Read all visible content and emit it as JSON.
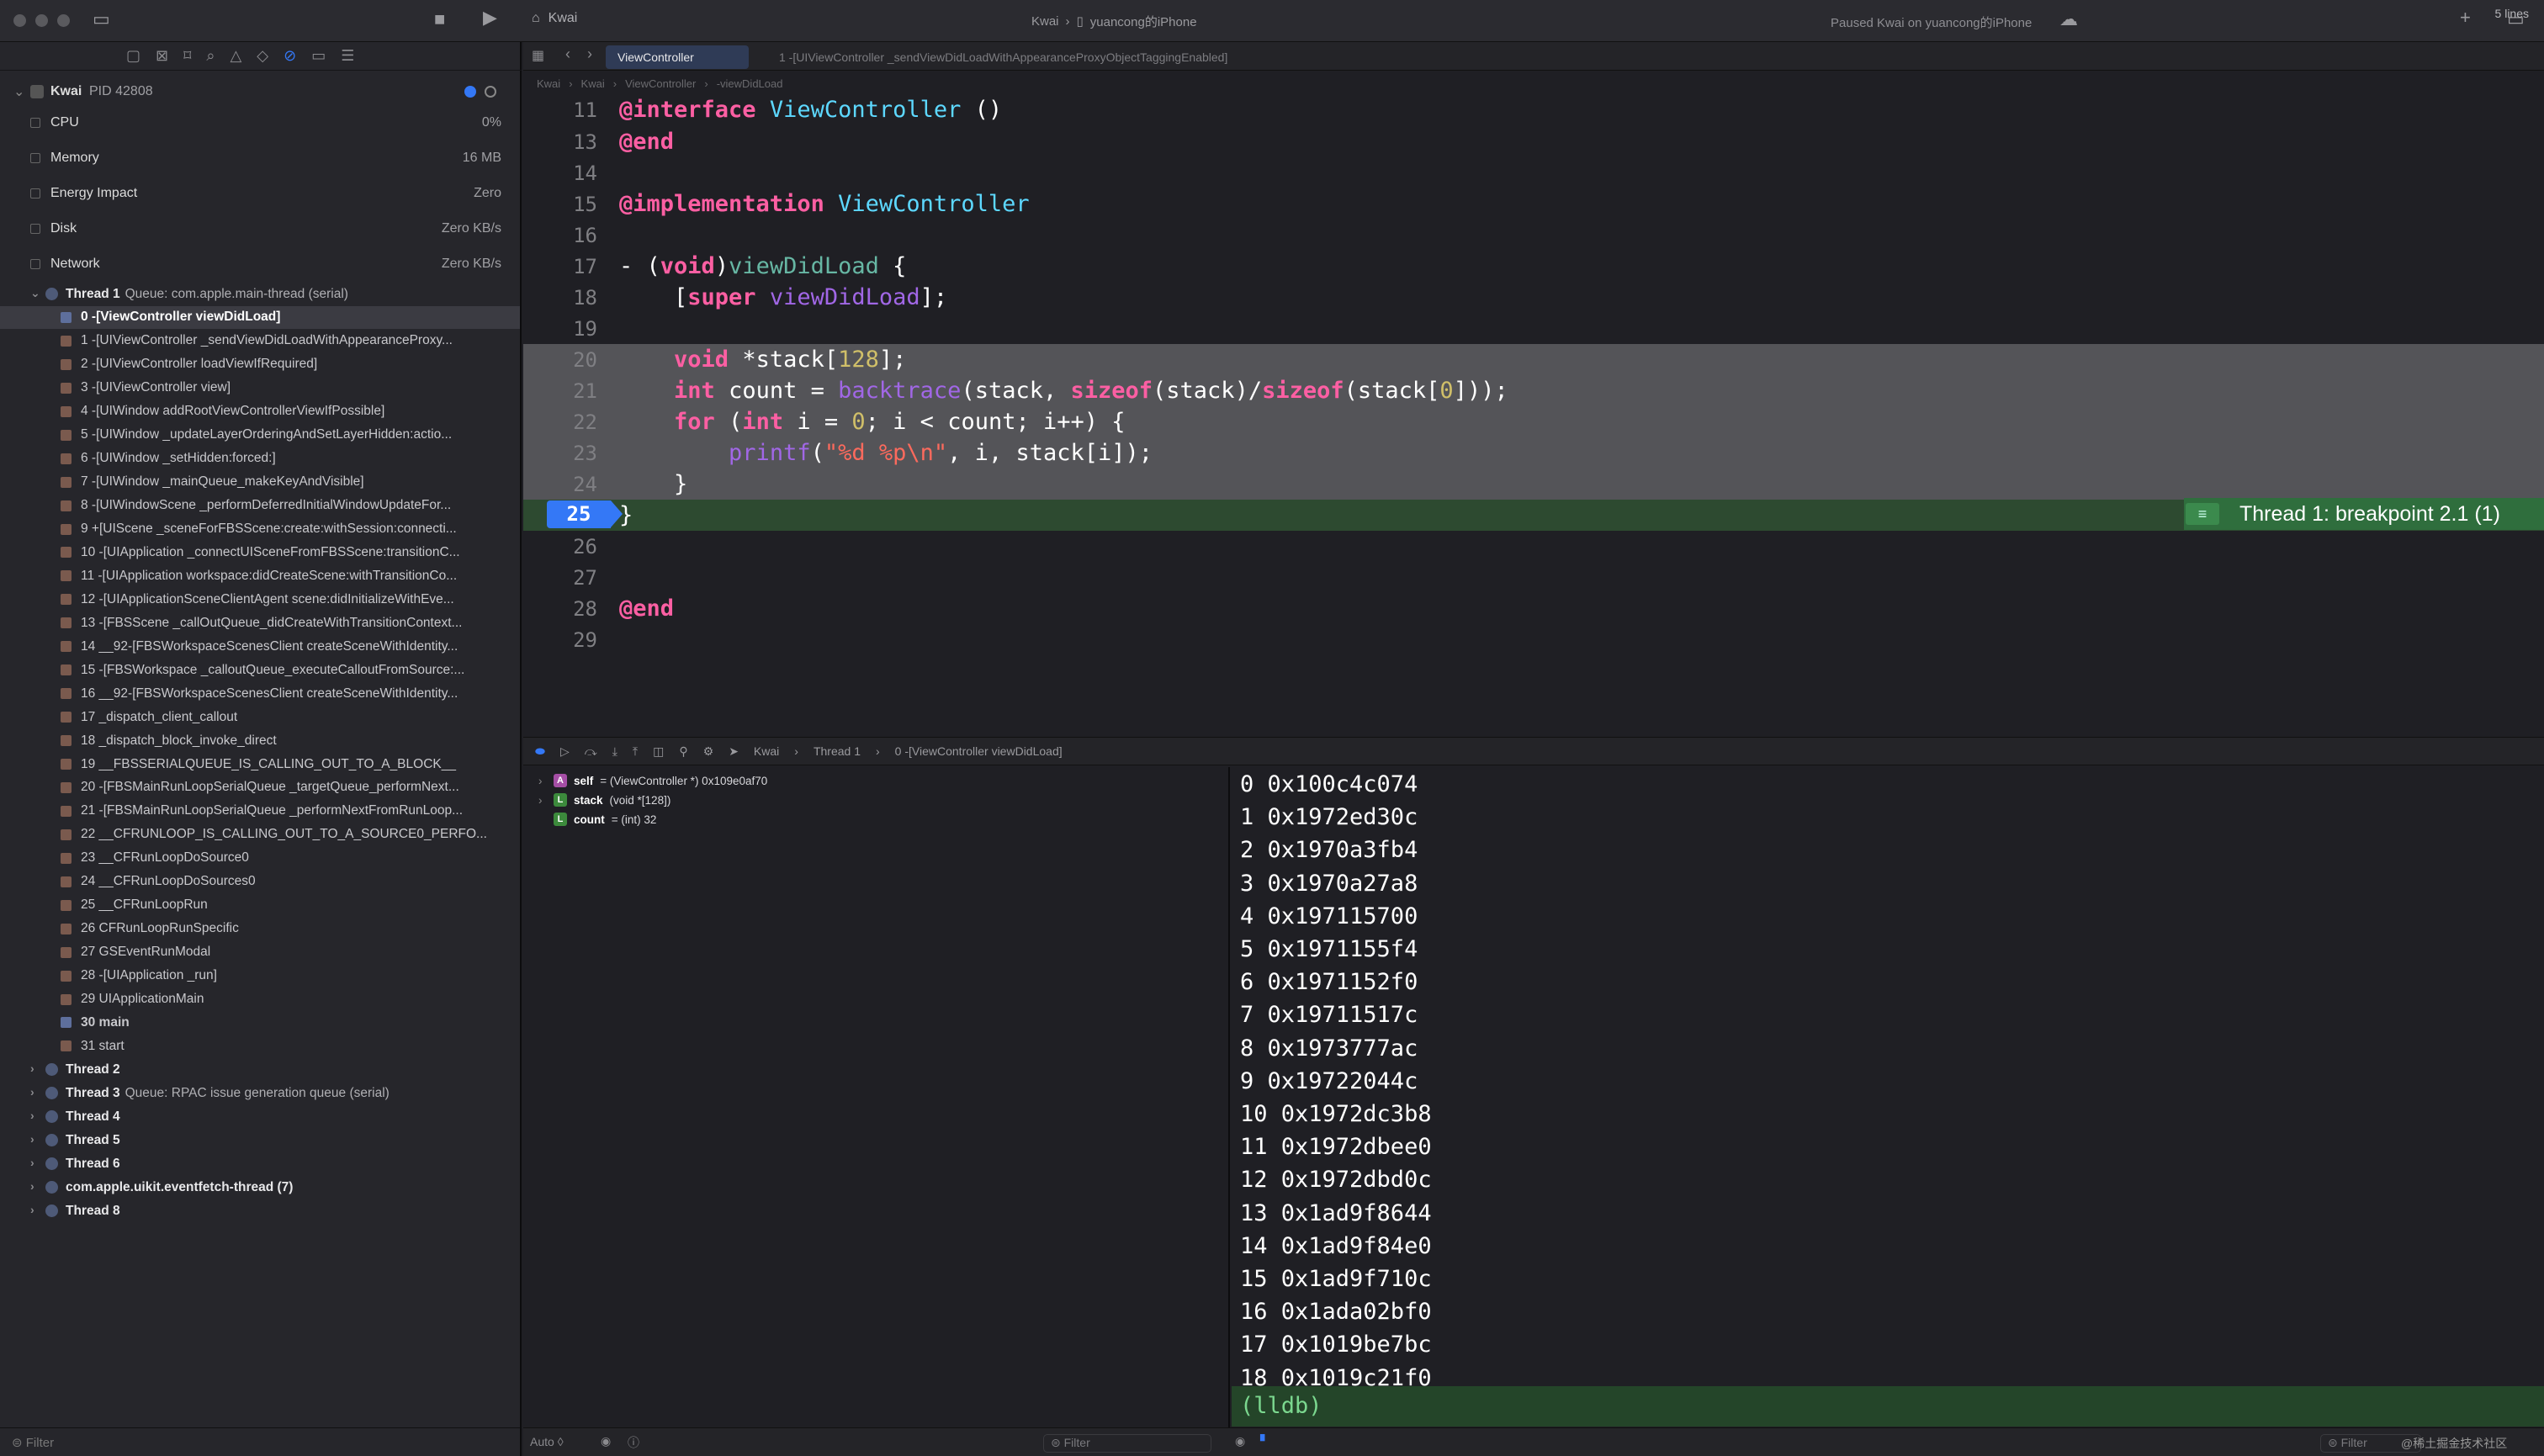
{
  "window": {
    "app_name": "Kwai",
    "scheme_target": "Kwai",
    "device": "yuancong的iPhone",
    "status": "Paused Kwai on yuancong的iPhone"
  },
  "tabs": [
    {
      "label": "ViewController"
    },
    {
      "label": "1 -[UIViewController _sendViewDidLoadWithAppearanceProxyObjectTaggingEnabled]"
    }
  ],
  "jumpbar": [
    "Kwai",
    "Kwai",
    "ViewController",
    "-viewDidLoad"
  ],
  "process": {
    "name": "Kwai",
    "pid": "PID 42808",
    "gauges": [
      {
        "name": "CPU",
        "value": "0%"
      },
      {
        "name": "Memory",
        "value": "16 MB"
      },
      {
        "name": "Energy Impact",
        "value": "Zero"
      },
      {
        "name": "Disk",
        "value": "Zero KB/s"
      },
      {
        "name": "Network",
        "value": "Zero KB/s"
      }
    ]
  },
  "thread1": {
    "label": "Thread 1",
    "queue": "Queue: com.apple.main-thread (serial)",
    "frames": [
      "0 -[ViewController viewDidLoad]",
      "1 -[UIViewController _sendViewDidLoadWithAppearanceProxy...",
      "2 -[UIViewController loadViewIfRequired]",
      "3 -[UIViewController view]",
      "4 -[UIWindow addRootViewControllerViewIfPossible]",
      "5 -[UIWindow _updateLayerOrderingAndSetLayerHidden:actio...",
      "6 -[UIWindow _setHidden:forced:]",
      "7 -[UIWindow _mainQueue_makeKeyAndVisible]",
      "8 -[UIWindowScene _performDeferredInitialWindowUpdateFor...",
      "9 +[UIScene _sceneForFBSScene:create:withSession:connecti...",
      "10 -[UIApplication _connectUISceneFromFBSScene:transitionC...",
      "11 -[UIApplication workspace:didCreateScene:withTransitionCo...",
      "12 -[UIApplicationSceneClientAgent scene:didInitializeWithEve...",
      "13 -[FBSScene _callOutQueue_didCreateWithTransitionContext...",
      "14 __92-[FBSWorkspaceScenesClient createSceneWithIdentity...",
      "15 -[FBSWorkspace _calloutQueue_executeCalloutFromSource:...",
      "16 __92-[FBSWorkspaceScenesClient createSceneWithIdentity...",
      "17 _dispatch_client_callout",
      "18 _dispatch_block_invoke_direct",
      "19 __FBSSERIALQUEUE_IS_CALLING_OUT_TO_A_BLOCK__",
      "20 -[FBSMainRunLoopSerialQueue _targetQueue_performNext...",
      "21 -[FBSMainRunLoopSerialQueue _performNextFromRunLoop...",
      "22 __CFRUNLOOP_IS_CALLING_OUT_TO_A_SOURCE0_PERFO...",
      "23 __CFRunLoopDoSource0",
      "24 __CFRunLoopDoSources0",
      "25 __CFRunLoopRun",
      "26 CFRunLoopRunSpecific",
      "27 GSEventRunModal",
      "28 -[UIApplication _run]",
      "29 UIApplicationMain",
      "30 main",
      "31 start"
    ]
  },
  "other_threads": [
    {
      "label": "Thread 2",
      "queue": ""
    },
    {
      "label": "Thread 3",
      "queue": "Queue: RPAC issue generation queue (serial)"
    },
    {
      "label": "Thread 4",
      "queue": ""
    },
    {
      "label": "Thread 5",
      "queue": ""
    },
    {
      "label": "Thread 6",
      "queue": ""
    },
    {
      "label": "com.apple.uikit.eventfetch-thread (7)",
      "queue": ""
    },
    {
      "label": "Thread 8",
      "queue": ""
    }
  ],
  "nav_filter": "Filter",
  "code": {
    "lines": [
      "11",
      "13",
      "14",
      "15",
      "16",
      "17",
      "18",
      "19",
      "20",
      "21",
      "22",
      "23",
      "24",
      "25",
      "26",
      "27",
      "28",
      "29"
    ],
    "current_line": "25",
    "breakpoint_label": "Thread 1: breakpoint 2.1 (1)"
  },
  "debugbar": {
    "crumbs": [
      "Kwai",
      "Thread 1",
      "0 -[ViewController viewDidLoad]"
    ],
    "lines": "5 lines"
  },
  "variables": [
    {
      "badge": "A",
      "name": "self",
      "value": "= (ViewController *) 0x109e0af70",
      "color": "#a54ea5"
    },
    {
      "badge": "L",
      "name": "stack",
      "value": "(void *[128])",
      "color": "#3c8a3c"
    },
    {
      "badge": "L",
      "name": "count",
      "value": "= (int) 32",
      "color": "#3c8a3c"
    }
  ],
  "console": [
    "0 0x100c4c074",
    "1 0x1972ed30c",
    "2 0x1970a3fb4",
    "3 0x1970a27a8",
    "4 0x197115700",
    "5 0x1971155f4",
    "6 0x1971152f0",
    "7 0x19711517c",
    "8 0x1973777ac",
    "9 0x19722044c",
    "10 0x1972dc3b8",
    "11 0x1972dbee0",
    "12 0x1972dbd0c",
    "13 0x1ad9f8644",
    "14 0x1ad9f84e0",
    "15 0x1ad9f710c",
    "16 0x1ada02bf0",
    "17 0x1019be7bc",
    "18 0x1019c21f0"
  ],
  "lldb_prompt": "(lldb)",
  "bottom": {
    "auto_label": "Auto ◊",
    "var_filter": "Filter",
    "con_filter": "Filter",
    "watermark": "@稀土掘金技术社区"
  }
}
